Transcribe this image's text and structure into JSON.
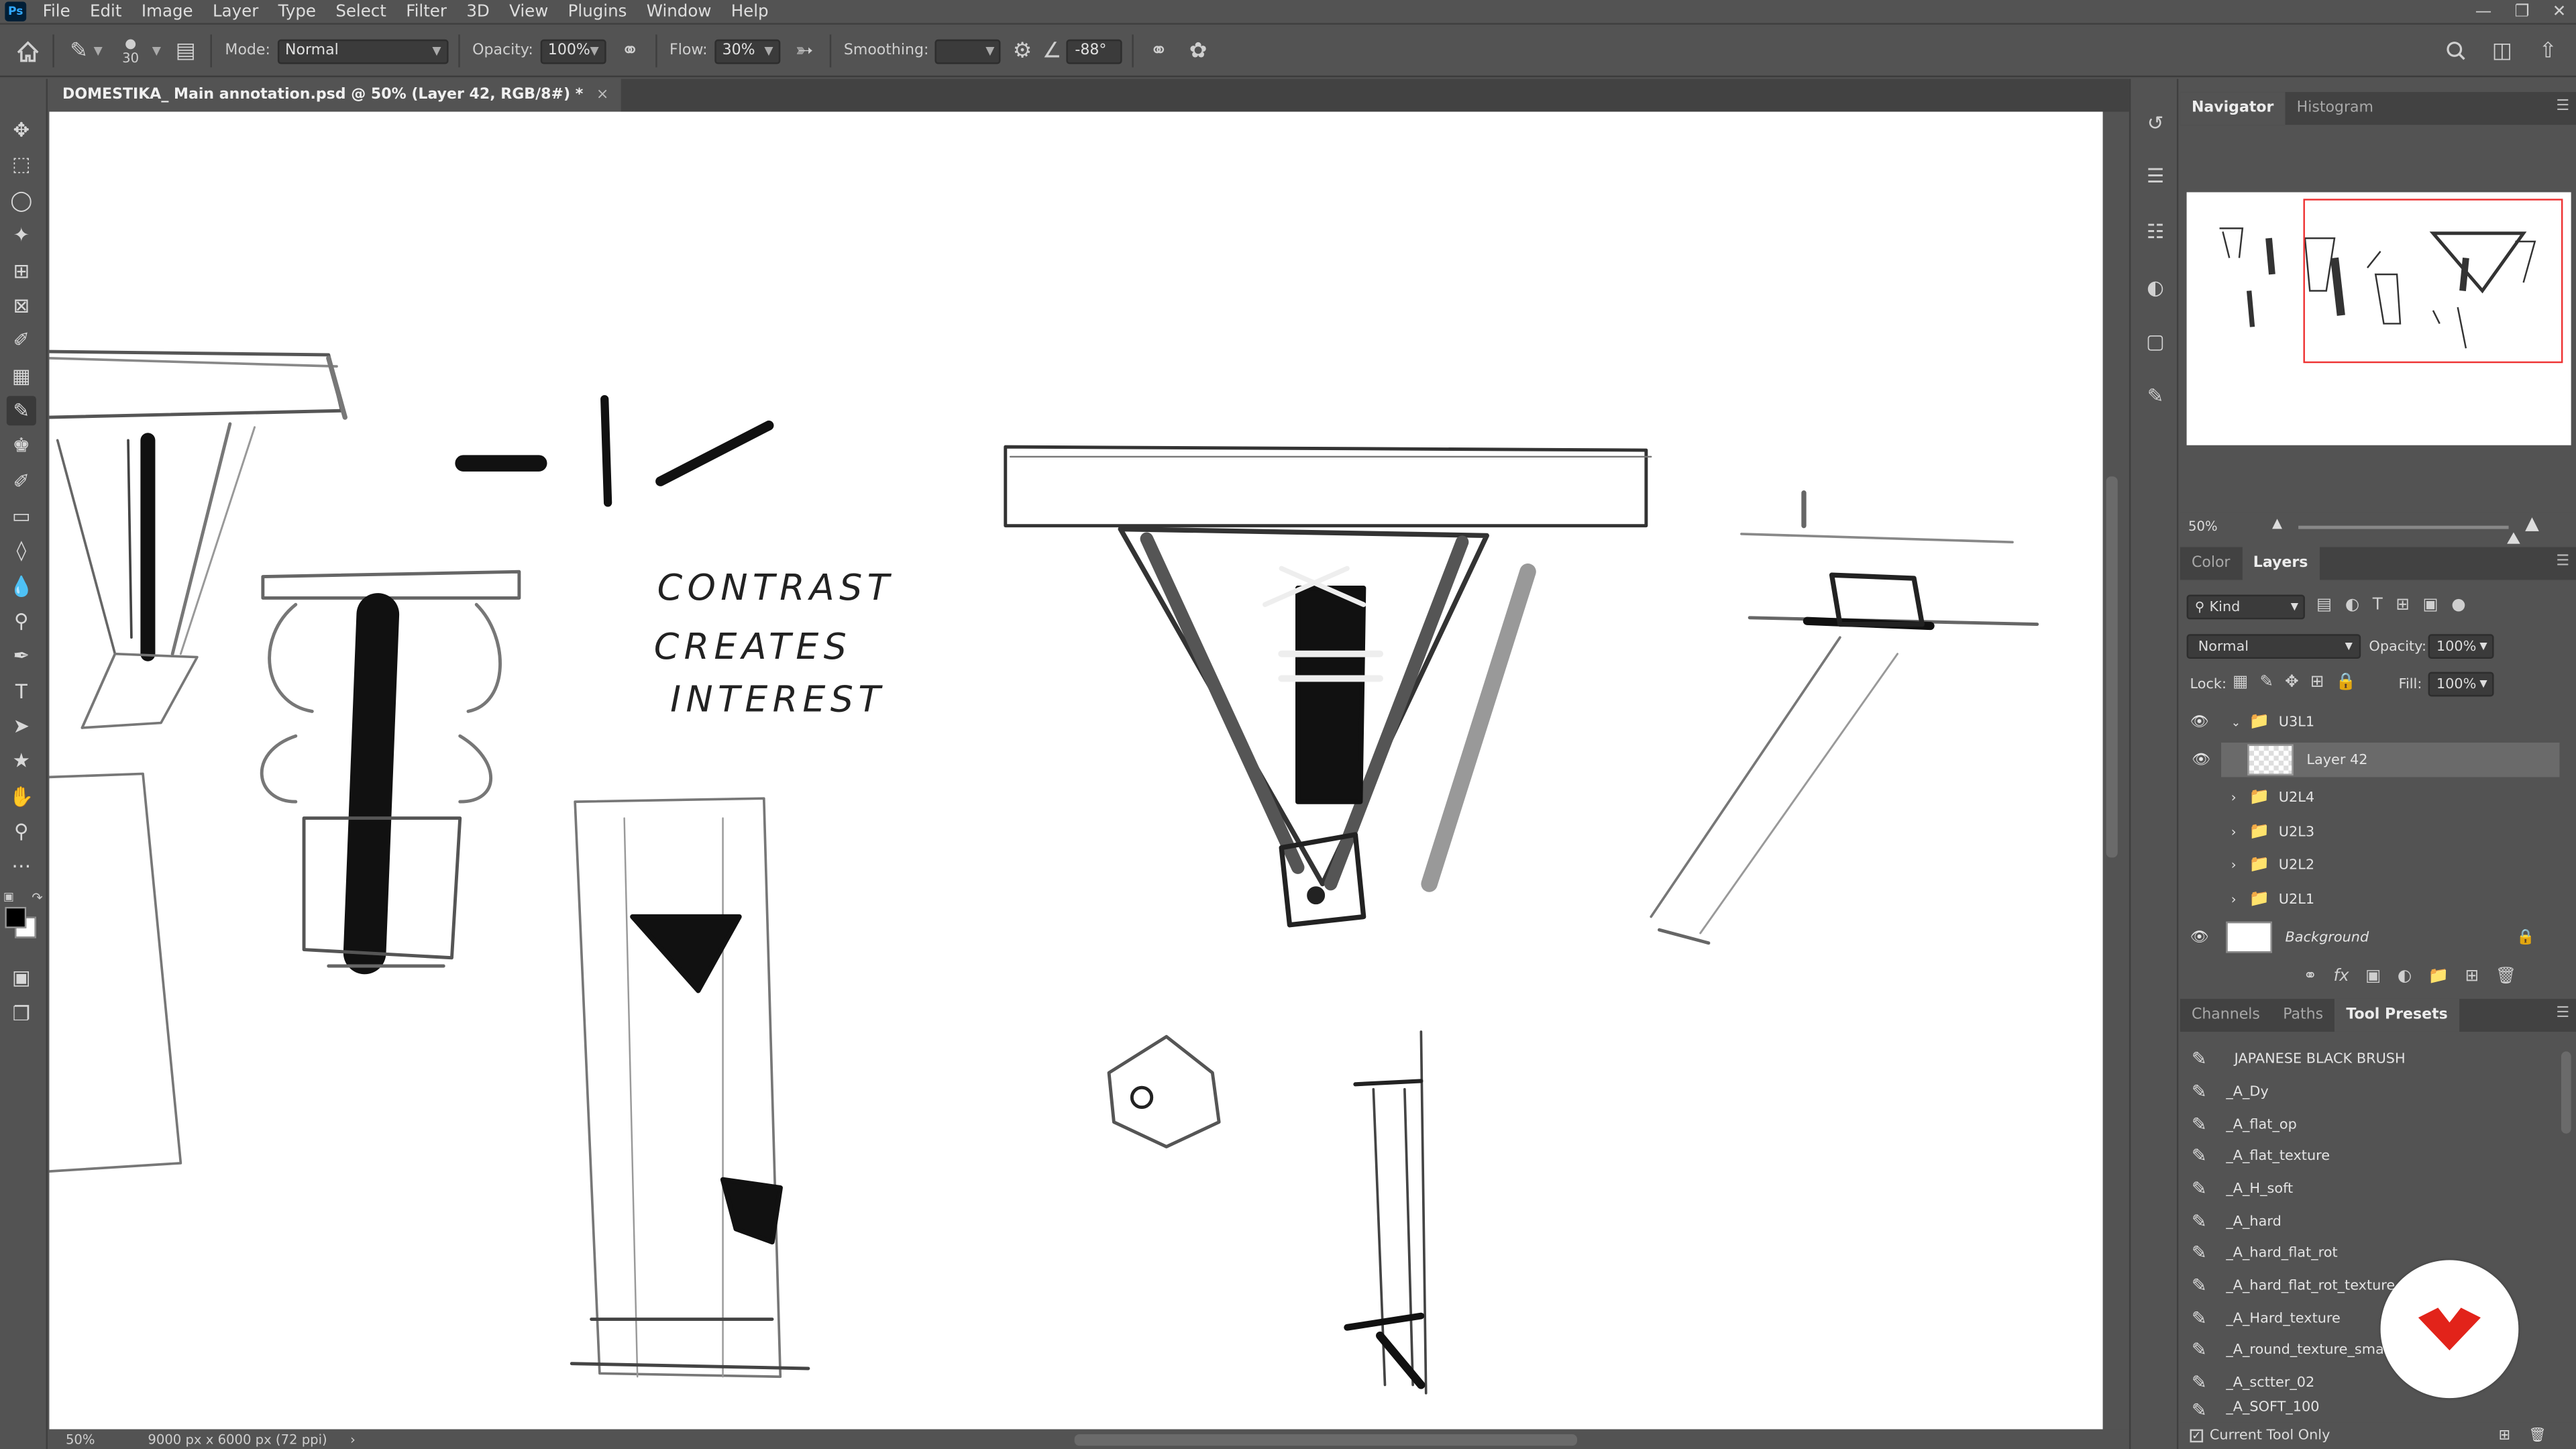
{
  "app": {
    "logo": "Ps"
  },
  "menu": [
    "File",
    "Edit",
    "Image",
    "Layer",
    "Type",
    "Select",
    "Filter",
    "3D",
    "View",
    "Plugins",
    "Window",
    "Help"
  ],
  "options": {
    "brush_size": "30",
    "mode_label": "Mode:",
    "mode_value": "Normal",
    "opacity_label": "Opacity:",
    "opacity_value": "100%",
    "flow_label": "Flow:",
    "flow_value": "30%",
    "smoothing_label": "Smoothing:",
    "smoothing_value": "",
    "angle_value": "-88°"
  },
  "document": {
    "tab_title": "DOMESTIKA_ Main annotation.psd @ 50% (Layer 42, RGB/8#) *",
    "close": "×",
    "zoom": "50%",
    "size_info": "9000 px x 6000 px (72 ppi)",
    "sketch_text": [
      "CONTRAST",
      "CREATES",
      "INTEREST"
    ]
  },
  "navigator_panel": {
    "tabs": [
      "Navigator",
      "Histogram"
    ],
    "zoom": "50%"
  },
  "layers_panel": {
    "tabs": [
      "Color",
      "Layers"
    ],
    "filter_kind": "Kind",
    "blend_mode": "Normal",
    "opacity_label": "Opacity:",
    "opacity_value": "100%",
    "lock_label": "Lock:",
    "fill_label": "Fill:",
    "fill_value": "100%",
    "layers": [
      {
        "name": "U3L1",
        "type": "group",
        "visible": true,
        "expanded": true
      },
      {
        "name": "Layer 42",
        "type": "layer",
        "visible": true,
        "selected": true
      },
      {
        "name": "U2L4",
        "type": "group",
        "visible": false
      },
      {
        "name": "U2L3",
        "type": "group",
        "visible": false
      },
      {
        "name": "U2L2",
        "type": "group",
        "visible": false
      },
      {
        "name": "U2L1",
        "type": "group",
        "visible": false
      },
      {
        "name": "Background",
        "type": "background",
        "visible": true,
        "locked": true
      }
    ]
  },
  "presets_panel": {
    "tabs": [
      "Channels",
      "Paths",
      "Tool Presets"
    ],
    "items": [
      "JAPANESE BLACK BRUSH",
      "_A_Dy",
      "_A_flat_op",
      "_A_flat_texture",
      "_A_H_soft",
      "_A_hard",
      "_A_hard_flat_rot",
      "_A_hard_flat_rot_texture",
      "_A_Hard_texture",
      "_A_round_texture_small",
      "_A_sctter_02",
      "_A_SOFT_100"
    ],
    "footer_checkbox": "Current Tool Only"
  },
  "colors": {
    "brand": "#e2231a",
    "panel": "#535353",
    "canvas": "#ffffff"
  }
}
